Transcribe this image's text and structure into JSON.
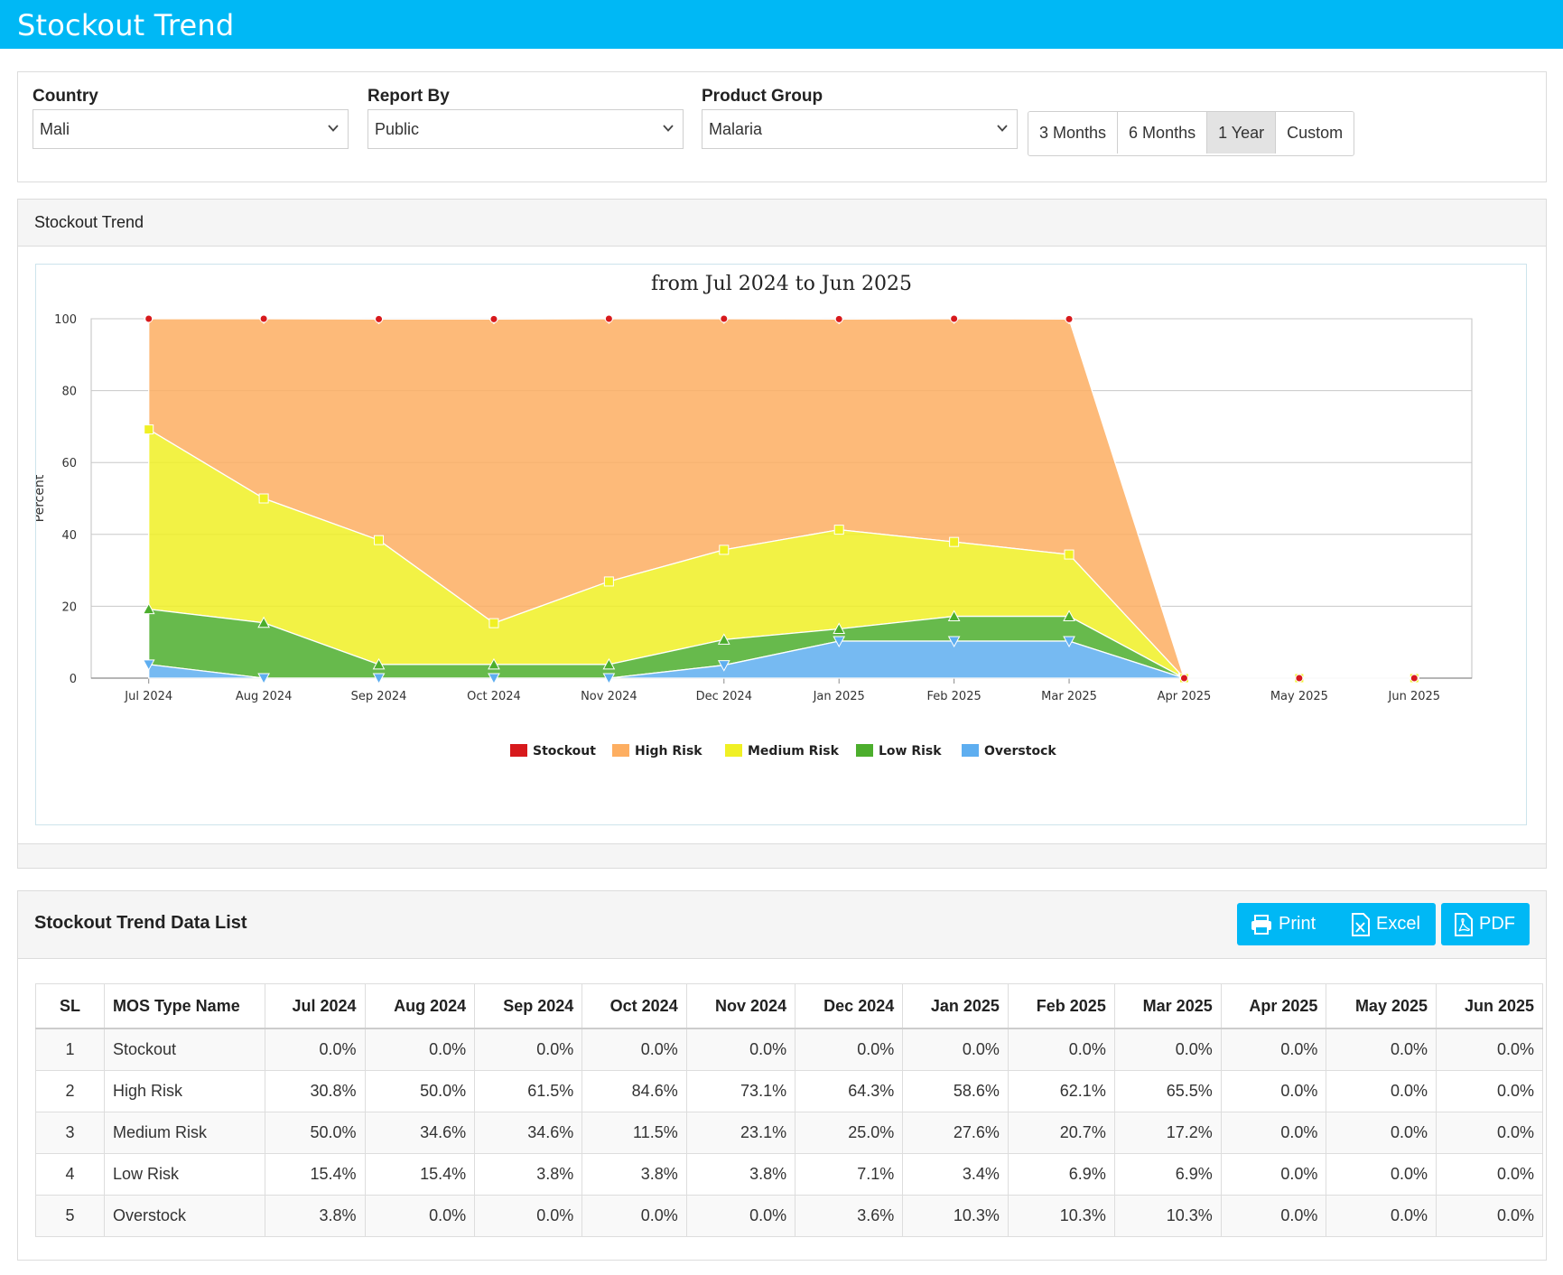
{
  "header": {
    "title": "Stockout Trend"
  },
  "filters": {
    "country": {
      "label": "Country",
      "value": "Mali"
    },
    "report_by": {
      "label": "Report By",
      "value": "Public"
    },
    "product_group": {
      "label": "Product Group",
      "value": "Malaria"
    },
    "periods": [
      "3 Months",
      "6 Months",
      "1 Year",
      "Custom"
    ],
    "active_period": "1 Year"
  },
  "chart_panel": {
    "title": "Stockout Trend"
  },
  "chart_data": {
    "type": "area",
    "stacked": true,
    "title": "from Jul 2024 to Jun 2025",
    "ylabel": "Percent",
    "ylim": [
      0,
      100
    ],
    "yticks": [
      0,
      20,
      40,
      60,
      80,
      100
    ],
    "grid": true,
    "legend_position": "bottom",
    "categories": [
      "Jul 2024",
      "Aug 2024",
      "Sep 2024",
      "Oct 2024",
      "Nov 2024",
      "Dec 2024",
      "Jan 2025",
      "Feb 2025",
      "Mar 2025",
      "Apr 2025",
      "May 2025",
      "Jun 2025"
    ],
    "series": [
      {
        "name": "Stockout",
        "color": "#d7191c",
        "values": [
          0,
          0,
          0,
          0,
          0,
          0,
          0,
          0,
          0,
          0,
          0,
          0
        ]
      },
      {
        "name": "High Risk",
        "color": "#fdae61",
        "values": [
          30.8,
          50.0,
          61.5,
          84.6,
          73.1,
          64.3,
          58.6,
          62.1,
          65.5,
          0,
          0,
          0
        ]
      },
      {
        "name": "Medium Risk",
        "color": "#f0f024",
        "values": [
          50.0,
          34.6,
          34.6,
          11.5,
          23.1,
          25.0,
          27.6,
          20.7,
          17.2,
          0,
          0,
          0
        ]
      },
      {
        "name": "Low Risk",
        "color": "#4cae2d",
        "values": [
          15.4,
          15.4,
          3.8,
          3.8,
          3.8,
          7.1,
          3.4,
          6.9,
          6.9,
          0,
          0,
          0
        ]
      },
      {
        "name": "Overstock",
        "color": "#5eaef0",
        "values": [
          3.8,
          0,
          0,
          0,
          0,
          3.6,
          10.3,
          10.3,
          10.3,
          0,
          0,
          0
        ]
      }
    ]
  },
  "table_panel": {
    "title": "Stockout Trend Data List",
    "buttons": {
      "print": "Print",
      "excel": "Excel",
      "pdf": "PDF"
    },
    "columns": [
      "SL",
      "MOS Type Name",
      "Jul 2024",
      "Aug 2024",
      "Sep 2024",
      "Oct 2024",
      "Nov 2024",
      "Dec 2024",
      "Jan 2025",
      "Feb 2025",
      "Mar 2025",
      "Apr 2025",
      "May 2025",
      "Jun 2025"
    ],
    "rows": [
      [
        "1",
        "Stockout",
        "0.0%",
        "0.0%",
        "0.0%",
        "0.0%",
        "0.0%",
        "0.0%",
        "0.0%",
        "0.0%",
        "0.0%",
        "0.0%",
        "0.0%",
        "0.0%"
      ],
      [
        "2",
        "High Risk",
        "30.8%",
        "50.0%",
        "61.5%",
        "84.6%",
        "73.1%",
        "64.3%",
        "58.6%",
        "62.1%",
        "65.5%",
        "0.0%",
        "0.0%",
        "0.0%"
      ],
      [
        "3",
        "Medium Risk",
        "50.0%",
        "34.6%",
        "34.6%",
        "11.5%",
        "23.1%",
        "25.0%",
        "27.6%",
        "20.7%",
        "17.2%",
        "0.0%",
        "0.0%",
        "0.0%"
      ],
      [
        "4",
        "Low Risk",
        "15.4%",
        "15.4%",
        "3.8%",
        "3.8%",
        "3.8%",
        "7.1%",
        "3.4%",
        "6.9%",
        "6.9%",
        "0.0%",
        "0.0%",
        "0.0%"
      ],
      [
        "5",
        "Overstock",
        "3.8%",
        "0.0%",
        "0.0%",
        "0.0%",
        "0.0%",
        "3.6%",
        "10.3%",
        "10.3%",
        "10.3%",
        "0.0%",
        "0.0%",
        "0.0%"
      ]
    ]
  }
}
